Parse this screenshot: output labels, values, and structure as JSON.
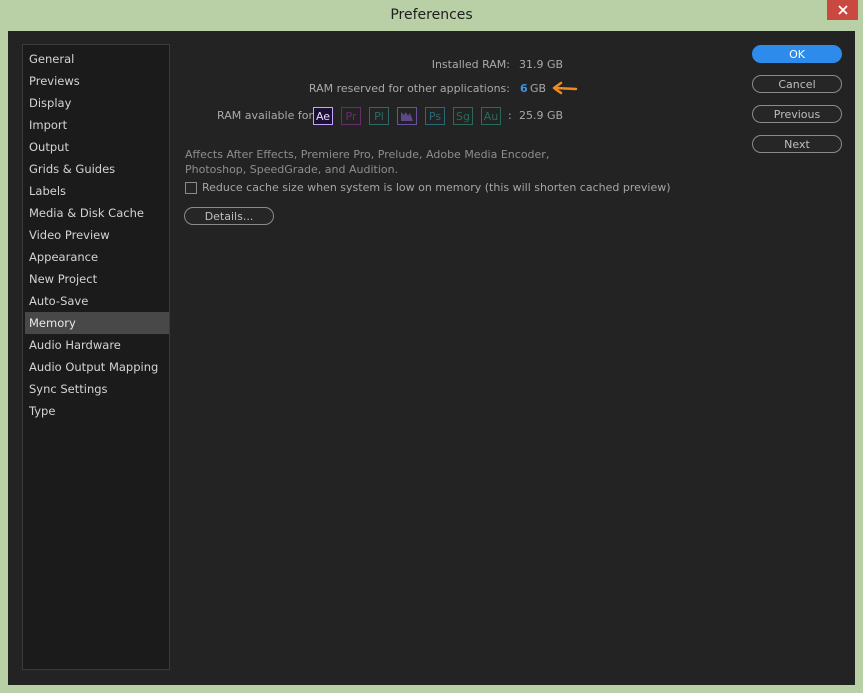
{
  "window": {
    "title": "Preferences"
  },
  "sidebar": {
    "items": [
      {
        "label": "General"
      },
      {
        "label": "Previews"
      },
      {
        "label": "Display"
      },
      {
        "label": "Import"
      },
      {
        "label": "Output"
      },
      {
        "label": "Grids & Guides"
      },
      {
        "label": "Labels"
      },
      {
        "label": "Media & Disk Cache"
      },
      {
        "label": "Video Preview"
      },
      {
        "label": "Appearance"
      },
      {
        "label": "New Project"
      },
      {
        "label": "Auto-Save"
      },
      {
        "label": "Memory"
      },
      {
        "label": "Audio Hardware"
      },
      {
        "label": "Audio Output Mapping"
      },
      {
        "label": "Sync Settings"
      },
      {
        "label": "Type"
      }
    ],
    "selected": "Memory"
  },
  "memory": {
    "installed_label": "Installed RAM:",
    "installed_value": "31.9 GB",
    "reserved_label": "RAM reserved for other applications:",
    "reserved_value": "6",
    "reserved_unit": "GB",
    "available_label": "RAM available for",
    "available_sep": ":",
    "available_value": "25.9 GB",
    "apps": [
      {
        "abbr": "Ae",
        "color": "#c9a1ff"
      },
      {
        "abbr": "Pr",
        "color": "#6b2c6d"
      },
      {
        "abbr": "Pl",
        "color": "#2e6a66"
      },
      {
        "abbr": "",
        "color": "#6b52a0"
      },
      {
        "abbr": "Ps",
        "color": "#2a6a78"
      },
      {
        "abbr": "Sg",
        "color": "#2a6a5a"
      },
      {
        "abbr": "Au",
        "color": "#2a6a5a"
      }
    ],
    "description": "Affects After Effects, Premiere Pro, Prelude, Adobe Media Encoder, Photoshop, SpeedGrade, and Audition.",
    "checkbox_label": "Reduce cache size when system is low on memory (this will shorten cached preview)",
    "details_label": "Details..."
  },
  "buttons": {
    "ok": "OK",
    "cancel": "Cancel",
    "previous": "Previous",
    "next": "Next"
  },
  "colors": {
    "accent": "#2d8ceb",
    "highlight_value": "#3d93e5",
    "annotation_arrow": "#f08a1c"
  }
}
